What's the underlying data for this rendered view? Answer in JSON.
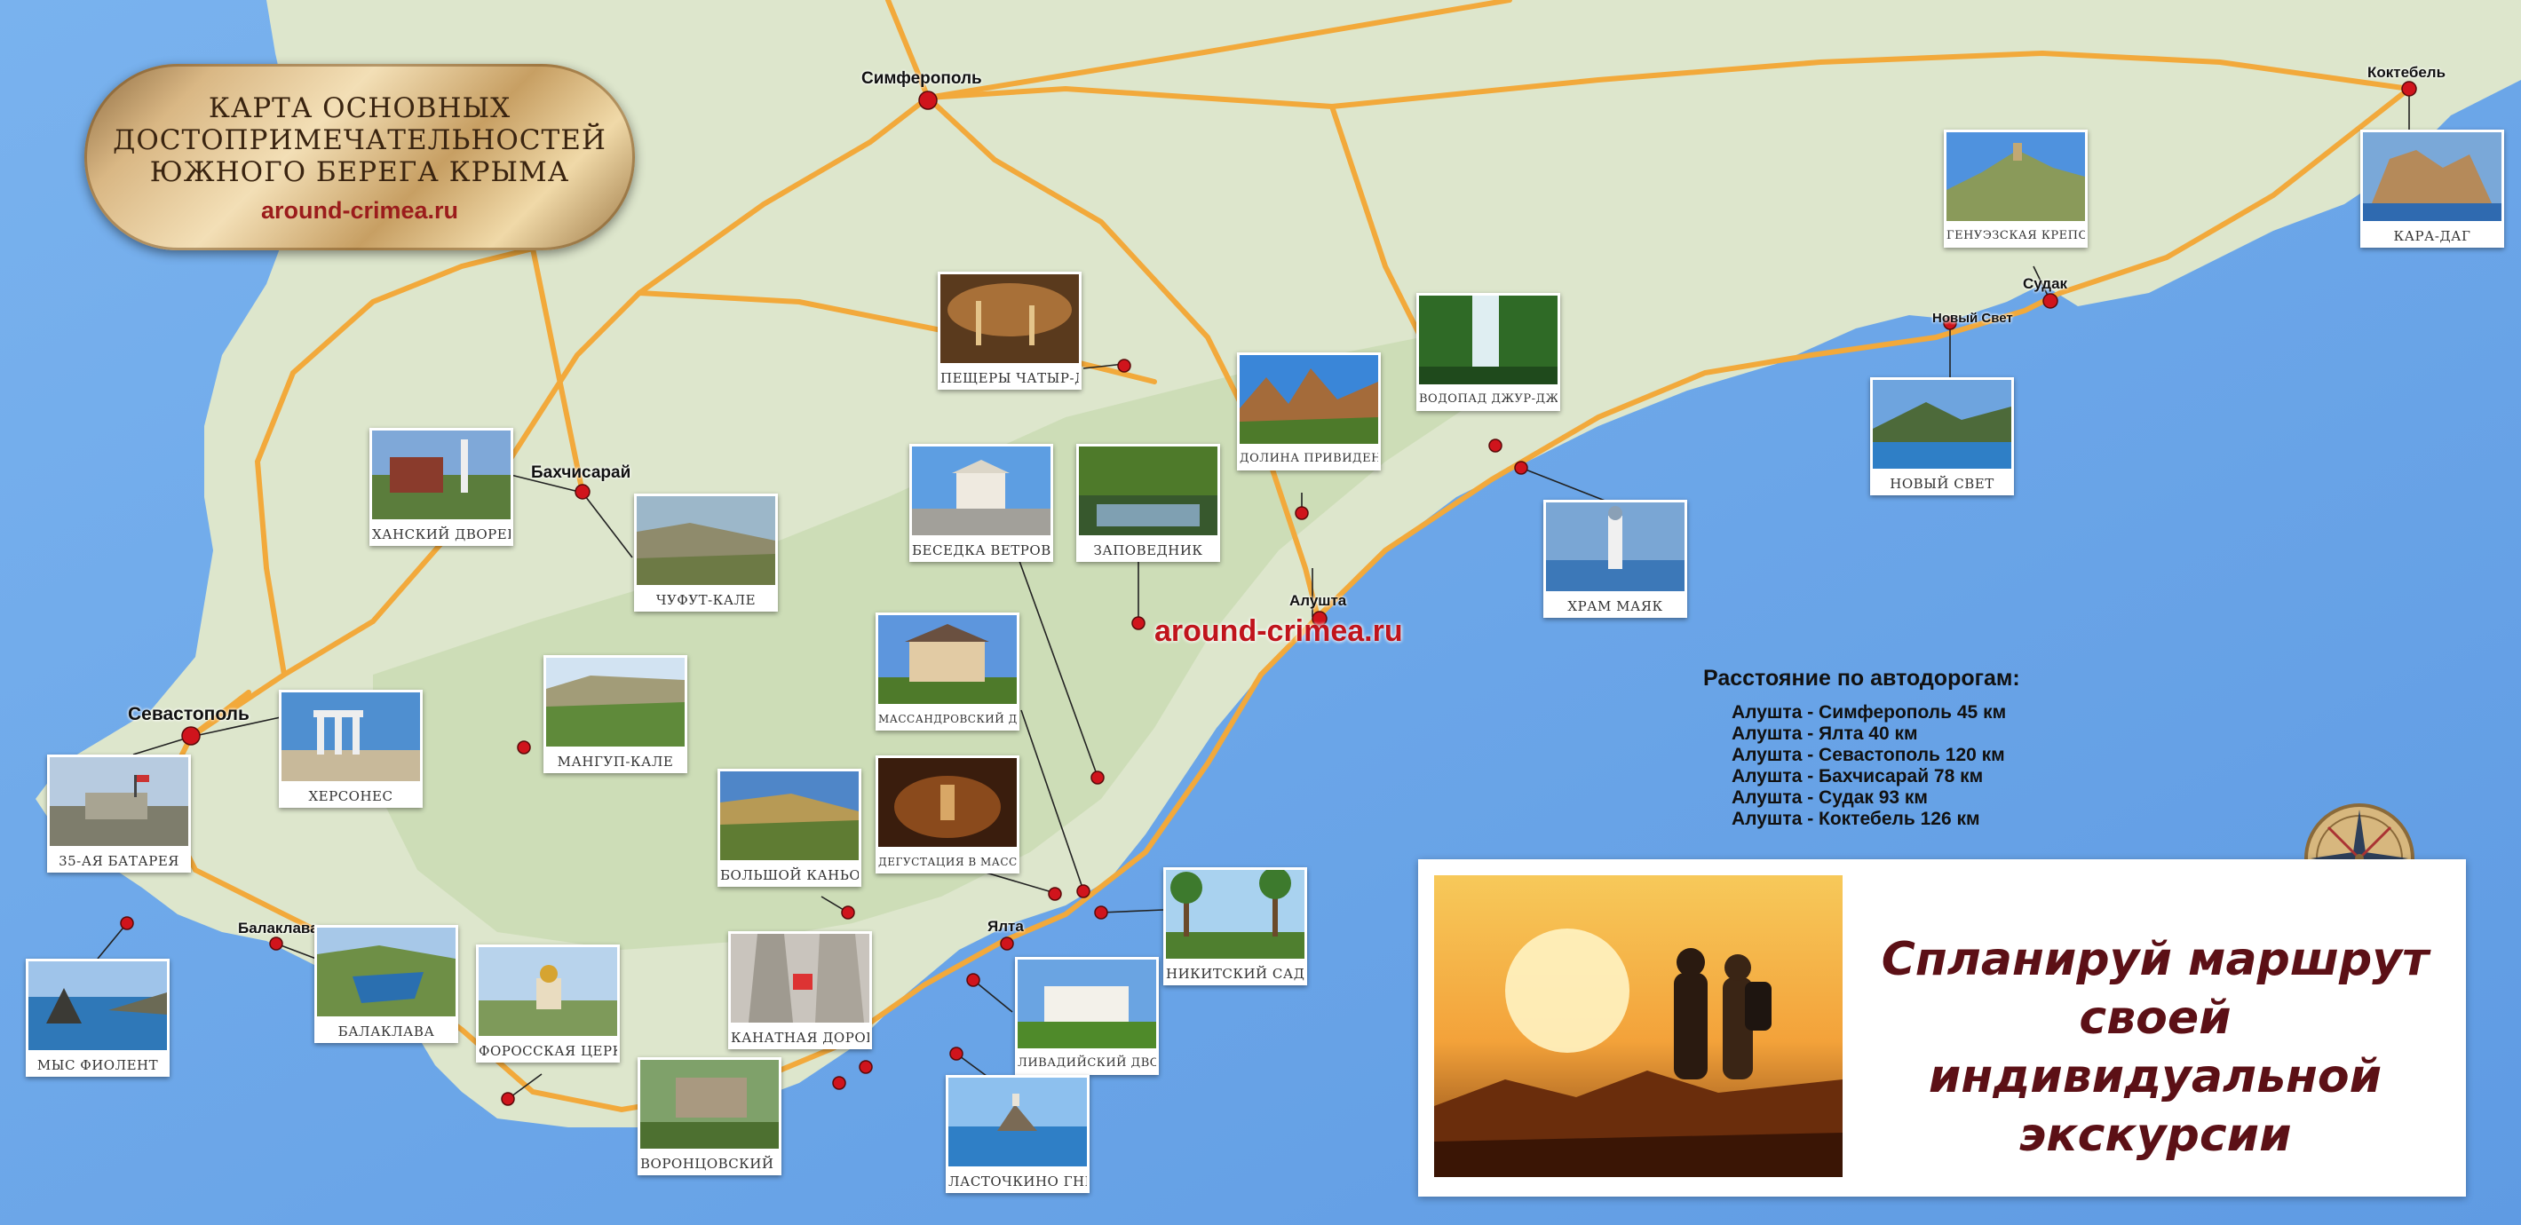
{
  "title": {
    "line1": "КАРТА ОСНОВНЫХ",
    "line2": "ДОСТОПРИМЕЧАТЕЛЬНОСТЕЙ",
    "line3": "ЮЖНОГО БЕРЕГА КРЫМА",
    "site": "around-crimea.ru"
  },
  "watermark": "around-crimea.ru",
  "cities": {
    "simferopol": "Симферополь",
    "bakhchisaray": "Бахчисарай",
    "sevastopol": "Севастополь",
    "balaklava": "Балаклава",
    "yalta": "Ялта",
    "alushta": "Алушта",
    "sudak": "Судак",
    "noviy_svet": "Новый Свет",
    "koktebel": "Коктебель"
  },
  "attractions": {
    "khan_palace": "ХАНСКИЙ ДВОРЕЦ",
    "chufut_kale": "ЧУФУТ-КАЛЕ",
    "chersonesus": "ХЕРСОНЕС",
    "battery35": "35-АЯ БАТАРЕЯ",
    "mangup": "МАНГУП-КАЛЕ",
    "fiolent": "МЫС ФИОЛЕНТ",
    "balaklava": "БАЛАКЛАВА",
    "foros": "ФОРОССКАЯ ЦЕРКОВЬ",
    "vorontsov": "ВОРОНЦОВСКИЙ ДВОРЕЦ",
    "big_canyon": "БОЛЬШОЙ КАНЬОН",
    "cable_car": "КАНАТНАЯ ДОРОГА",
    "chatyr_dag": "ПЕЩЕРЫ ЧАТЫР-ДАГА",
    "besedka": "БЕСЕДКА ВЕТРОВ",
    "zapovednik": "ЗАПОВЕДНИК",
    "massandra_palace": "МАССАНДРОВСКИЙ ДВОРЕЦ",
    "massandra_tasting": "ДЕГУСТАЦИЯ В МАССАНДРЕ",
    "nikitsky": "НИКИТСКИЙ САД",
    "livadia": "ЛИВАДИЙСКИЙ ДВОРЕЦ",
    "swallow": "ЛАСТОЧКИНО ГНЕЗДО",
    "ghosts_valley": "ДОЛИНА ПРИВИДЕНИЙ",
    "dzhur_dzhur": "ВОДОПАД ДЖУР-ДЖУР",
    "lighthouse_church": "ХРАМ МАЯК",
    "genoese": "ГЕНУЭЗСКАЯ КРЕПОСТЬ",
    "noviy_svet": "НОВЫЙ СВЕТ",
    "kara_dag": "КАРА-ДАГ"
  },
  "distances": {
    "heading": "Расстояние по автодорогам:",
    "rows": [
      "Алушта - Симферополь 45 км",
      "Алушта - Ялта 40 км",
      "Алушта - Севастополь 120 км",
      "Алушта - Бахчисарай 78 км",
      "Алушта - Судак 93 км",
      "Алушта - Коктебель 126 км"
    ]
  },
  "promo": {
    "line1": "Спланируй маршрут",
    "line2": "своей",
    "line3": "индивидуальной экскурсии"
  },
  "icons": {
    "marker": "red-dot-marker-icon",
    "compass": "compass-rose-icon"
  },
  "colors": {
    "sea": "#6fa8e8",
    "land": "#dfe8cf",
    "road": "#f2a93b",
    "marker": "#d0141c",
    "promo_text": "#5c1016"
  }
}
